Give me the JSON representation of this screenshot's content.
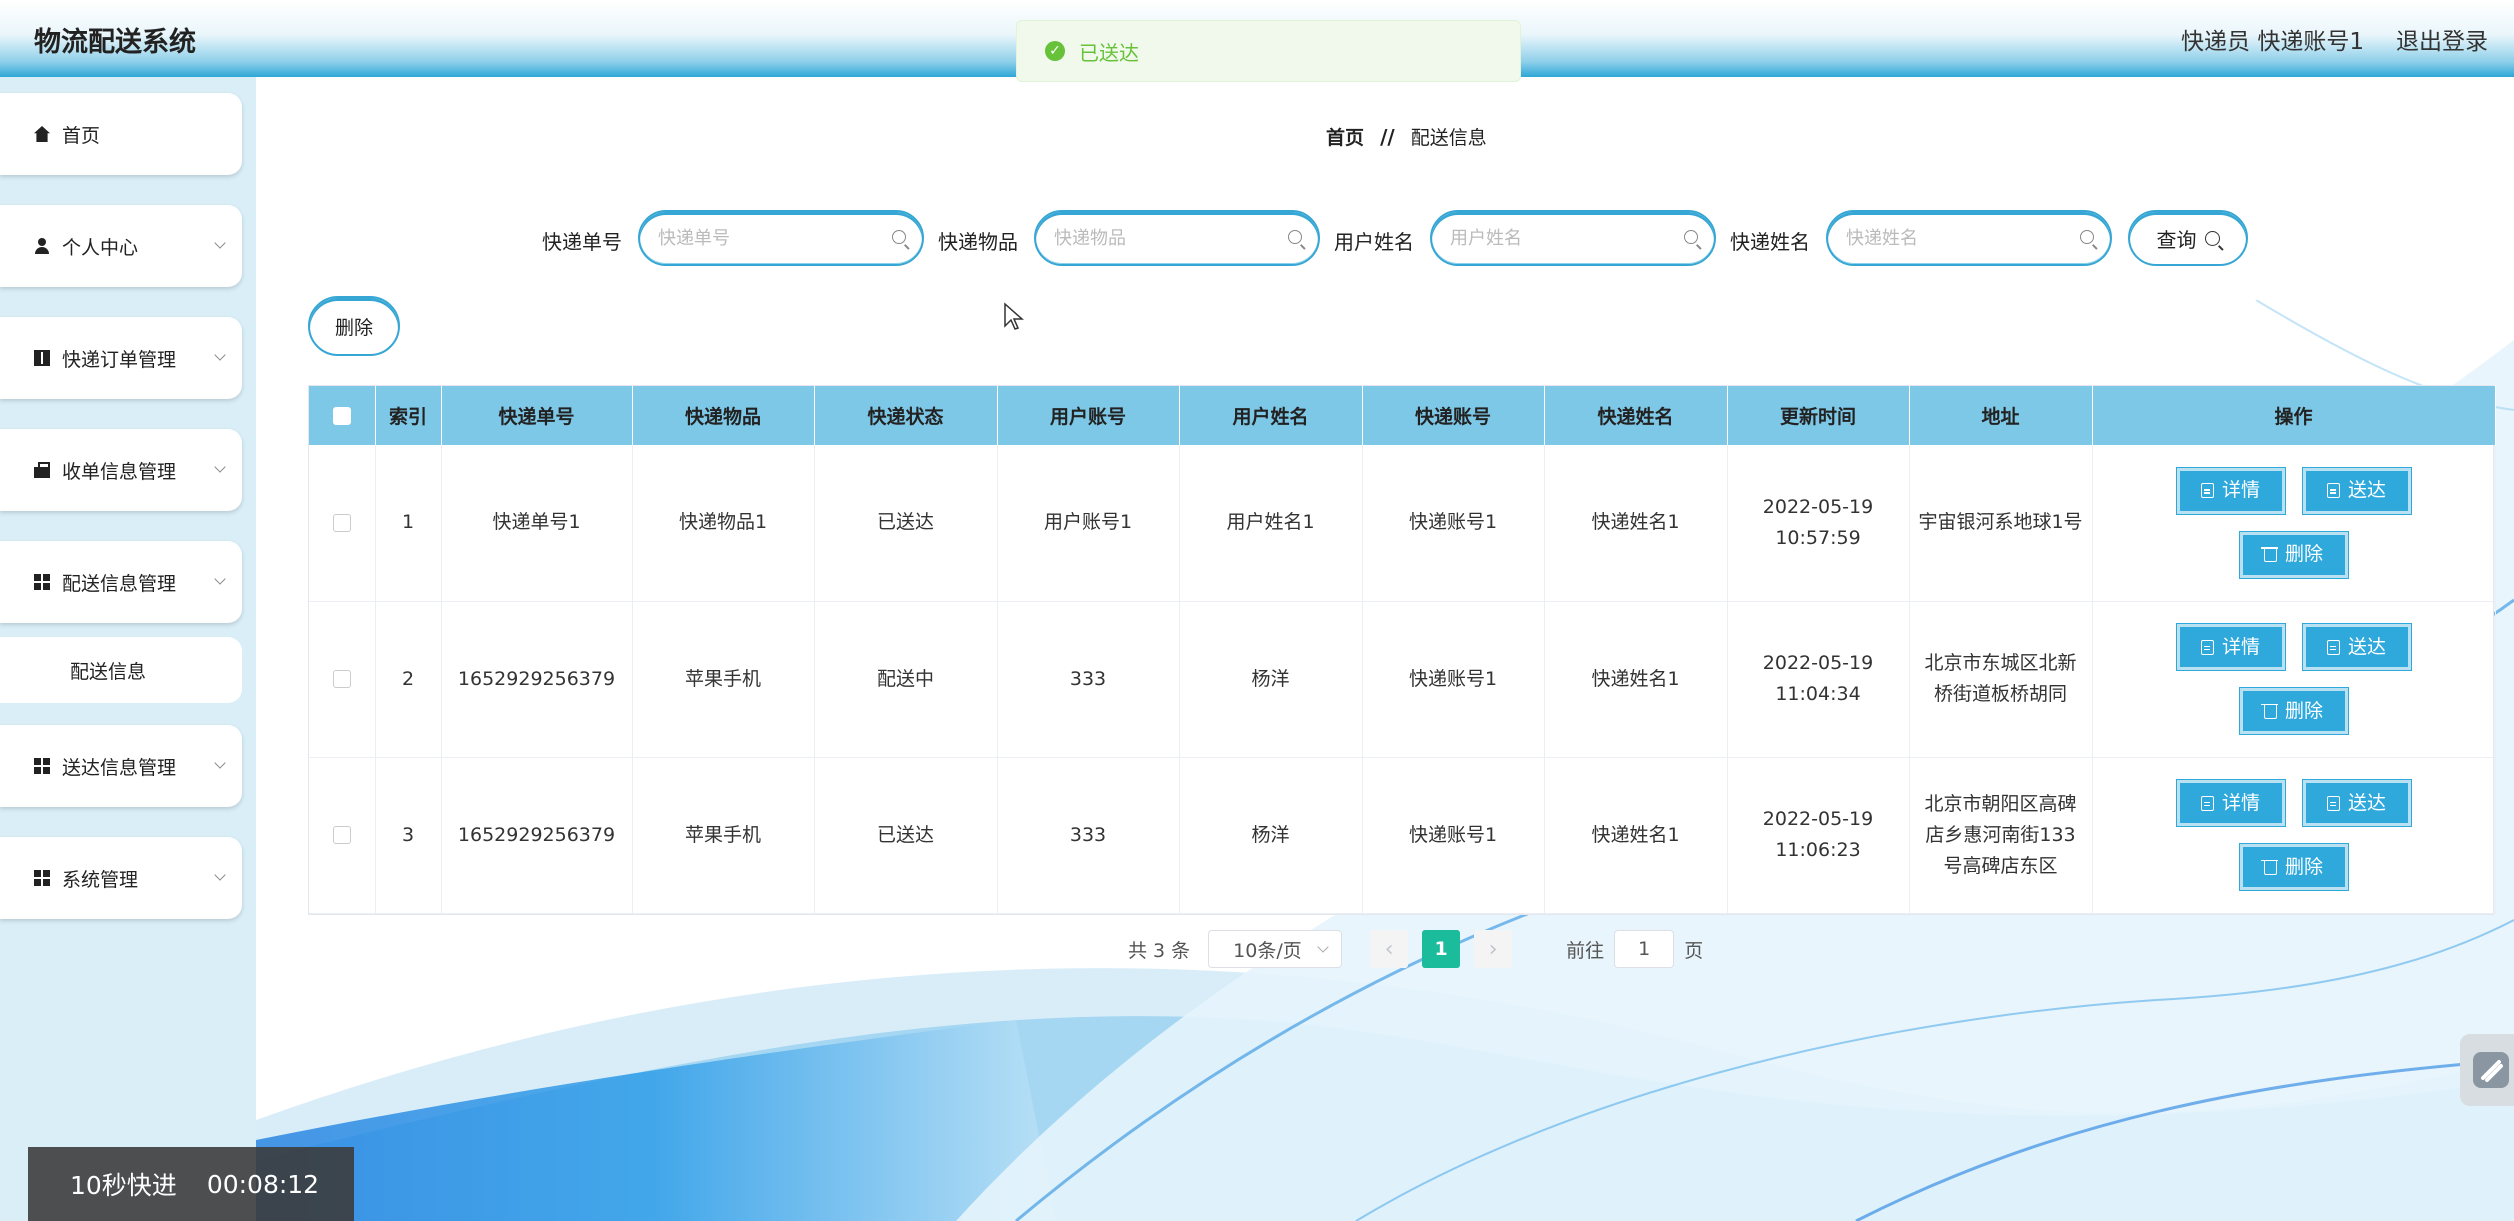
{
  "header": {
    "title": "物流配送系统",
    "user": "快递员 快递账号1",
    "logout": "退出登录"
  },
  "toast": {
    "message": "已送达"
  },
  "sidebar": {
    "items": [
      {
        "label": "首页",
        "icon": "home-icon"
      },
      {
        "label": "个人中心",
        "icon": "user-icon"
      },
      {
        "label": "快递订单管理",
        "icon": "book-icon"
      },
      {
        "label": "收单信息管理",
        "icon": "bag-icon"
      },
      {
        "label": "配送信息管理",
        "icon": "grid-icon"
      },
      {
        "label": "送达信息管理",
        "icon": "grid-icon"
      },
      {
        "label": "系统管理",
        "icon": "grid-icon"
      }
    ],
    "sub_item": "配送信息"
  },
  "breadcrumb": {
    "home": "首页",
    "separator": "//",
    "current": "配送信息"
  },
  "search": {
    "fields": [
      {
        "label": "快递单号",
        "placeholder": "快递单号"
      },
      {
        "label": "快递物品",
        "placeholder": "快递物品"
      },
      {
        "label": "用户姓名",
        "placeholder": "用户姓名"
      },
      {
        "label": "快递姓名",
        "placeholder": "快递姓名"
      }
    ],
    "query_label": "查询"
  },
  "toolbar": {
    "delete_label": "删除"
  },
  "table": {
    "headers": [
      "索引",
      "快递单号",
      "快递物品",
      "快递状态",
      "用户账号",
      "用户姓名",
      "快递账号",
      "快递姓名",
      "更新时间",
      "地址",
      "操作"
    ],
    "rows": [
      {
        "index": "1",
        "tracking_no": "快递单号1",
        "item": "快递物品1",
        "status": "已送达",
        "user_account": "用户账号1",
        "user_name": "用户姓名1",
        "courier_account": "快递账号1",
        "courier_name": "快递姓名1",
        "updated": "2022-05-19 10:57:59",
        "address": "宇宙银河系地球1号"
      },
      {
        "index": "2",
        "tracking_no": "1652929256379",
        "item": "苹果手机",
        "status": "配送中",
        "user_account": "333",
        "user_name": "杨洋",
        "courier_account": "快递账号1",
        "courier_name": "快递姓名1",
        "updated": "2022-05-19 11:04:34",
        "address": "北京市东城区北新桥街道板桥胡同"
      },
      {
        "index": "3",
        "tracking_no": "1652929256379",
        "item": "苹果手机",
        "status": "已送达",
        "user_account": "333",
        "user_name": "杨洋",
        "courier_account": "快递账号1",
        "courier_name": "快递姓名1",
        "updated": "2022-05-19 11:06:23",
        "address": "北京市朝阳区高碑店乡惠河南街133号高碑店东区"
      }
    ],
    "actions": {
      "detail": "详情",
      "deliver": "送达",
      "delete": "删除"
    }
  },
  "pagination": {
    "total": "共 3 条",
    "page_size": "10条/页",
    "prev": "‹",
    "current_page": "1",
    "next": "›",
    "goto_prefix": "前往",
    "goto_value": "1",
    "goto_suffix": "页"
  },
  "overlay": {
    "label": "10秒快进",
    "time": "00:08:12"
  }
}
